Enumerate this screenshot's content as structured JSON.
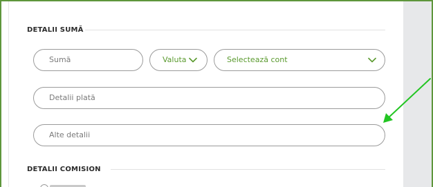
{
  "section_amount": {
    "title": "DETALII SUMĂ"
  },
  "amount_input": {
    "placeholder": "Sumă"
  },
  "currency_select": {
    "label": "Valuta",
    "icon": "chevron-down-icon"
  },
  "account_select": {
    "label": "Selectează cont",
    "icon": "chevron-down-icon"
  },
  "payment_details_input": {
    "placeholder": "Detalii plată"
  },
  "other_details_input": {
    "placeholder": "Alte detalii"
  },
  "section_commission": {
    "title": "DETALII COMISION"
  },
  "colors": {
    "accent_green": "#5a9a2e",
    "frame_green": "#5e963c",
    "arrow_green": "#22c522"
  }
}
